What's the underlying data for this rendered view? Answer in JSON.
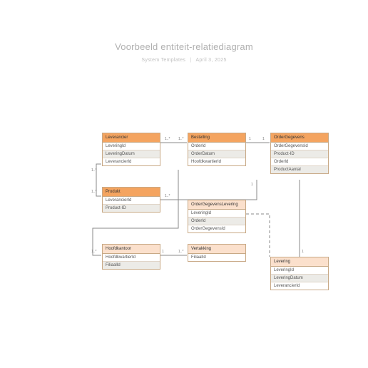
{
  "header": {
    "title": "Voorbeeld entiteit-relatiediagram",
    "meta_left": "System Templates",
    "meta_right": "April 3, 2025"
  },
  "entities": {
    "leverancier": {
      "name": "Leverancier",
      "attrs": [
        "LeveringId",
        "LeveringDatum",
        "LeverancierId"
      ]
    },
    "bestelling": {
      "name": "Bestelling",
      "attrs": [
        "OrderId",
        "OrderDatum",
        "HoofdkwartierId"
      ]
    },
    "ordergegevens": {
      "name": "OrderGegevens",
      "attrs": [
        "OrderGegevensId",
        "Product-ID",
        "OrderId",
        "ProductAantal"
      ]
    },
    "produkt": {
      "name": "Produkt",
      "attrs": [
        "LeverancierId",
        "Product-ID"
      ]
    },
    "ogl": {
      "name": "OrderGegevensLevering",
      "attrs": [
        "LeveringId",
        "OrderId",
        "OrderGegevensId"
      ]
    },
    "hoofdkantoor": {
      "name": "Hoofdkantoor",
      "attrs": [
        "HoofdkwartierId",
        "FiliaalId"
      ]
    },
    "vertakking": {
      "name": "Vertakking",
      "attrs": [
        "FiliaalId"
      ]
    },
    "levering": {
      "name": "Levering",
      "attrs": [
        "LeveringId",
        "LeveringDatum",
        "LeverancierId"
      ]
    }
  },
  "cardinalities": {
    "c1": "1..*",
    "c2": "1..*",
    "c3": "1..*",
    "c4": "1..*",
    "c5": "1",
    "c6": "1",
    "c7": "1..*",
    "c8": "1",
    "c9": "1",
    "c10": "1..*",
    "c11": "1..*",
    "c12": "1"
  }
}
